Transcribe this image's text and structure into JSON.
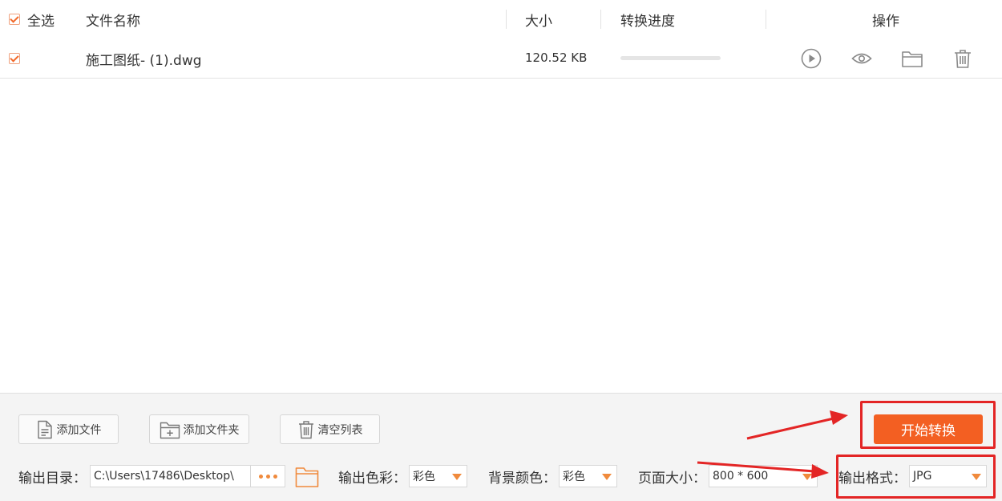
{
  "header": {
    "select_all": "全选",
    "col_name": "文件名称",
    "col_size": "大小",
    "col_progress": "转换进度",
    "col_actions": "操作"
  },
  "files": [
    {
      "name": "施工图纸- (1).dwg",
      "size": "120.52 KB",
      "progress": 0,
      "checked": true
    }
  ],
  "toolbar": {
    "add_file": "添加文件",
    "add_folder": "添加文件夹",
    "clear_list": "清空列表",
    "start": "开始转换"
  },
  "options": {
    "output_dir_label": "输出目录：",
    "output_dir_value": "C:\\Users\\17486\\Desktop\\",
    "color_label": "输出色彩：",
    "color_value": "彩色",
    "bg_label": "背景颜色：",
    "bg_value": "彩色",
    "page_label": "页面大小：",
    "page_value": "800 * 600",
    "format_label": "输出格式：",
    "format_value": "JPG"
  },
  "colors": {
    "accent": "#f35f22",
    "annotation": "#e32525"
  }
}
